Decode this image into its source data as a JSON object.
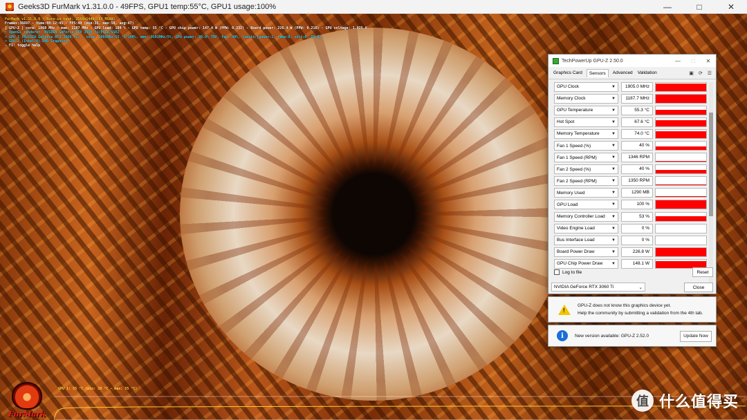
{
  "furmark": {
    "window_title": "Geeks3D FurMark v1.31.0.0 - 49FPS, GPU1 temp:55°C, GPU1 usage:100%",
    "hud": [
      {
        "text": "FurMark v1.31.0.0 - Burn-in test, 2560x1440 (8X MSAA)",
        "color": "#ffd633"
      },
      {
        "text": "Frames:36697 - time:00:12:45 - FPS:49 (min:35, max:58, avg:47)",
        "color": "#ffffff"
      },
      {
        "text": "[ GPU-Z ] core: 1860 MHz - mem: 1187 MHz - GPU load: 100 % - GPU temp: 55 °C - GPU chip power: 147.4 W (PPW: 0.332) - Board power: 226.4 W (PPW: 0.216) - GPU voltage: 1.025 V",
        "color": "#ffffff"
      },
      {
        "text": "> OpenGL renderer: NVIDIA GeForce RTX 3060 Ti/PCIe/SSE2",
        "color": "#33d6ff"
      },
      {
        "text": "> GPU 1 (NVIDIA GeForce RTX 3060 Ti) - core: 1905MHz/55 °C/100%, mem: 9501MHz/5%, GPU power: 99.8% TDP, fan: 40%, limits:[power:1, temp:0, volt:0, OV:0]",
        "color": "#33d6ff"
      },
      {
        "text": "> GPU 2 (Intel(R) UHD Graphics)",
        "color": "#33d6ff"
      },
      {
        "text": "- F1: toggle help",
        "color": "#ffffff"
      }
    ],
    "graph_label": "GPU 1: 55 °C (min: 28 °C - max: 55 °C)",
    "logo_text": "FurMark"
  },
  "gpuz": {
    "window_title": "TechPowerUp GPU-Z 2.50.0",
    "tabs": [
      "Graphics Card",
      "Sensors",
      "Advanced",
      "Validation"
    ],
    "active_tab": "Sensors",
    "sensors": [
      {
        "name": "GPU Clock",
        "value": "1905.0 MHz",
        "level": 0.9
      },
      {
        "name": "Memory Clock",
        "value": "1187.7 MHz",
        "level": 0.95
      },
      {
        "name": "GPU Temperature",
        "value": "55.3 °C",
        "level": 0.55
      },
      {
        "name": "Hot Spot",
        "value": "67.6 °C",
        "level": 0.7
      },
      {
        "name": "Memory Temperature",
        "value": "74.0 °C",
        "level": 0.8
      },
      {
        "name": "Fan 1 Speed (%)",
        "value": "40 %",
        "level": 0.4
      },
      {
        "name": "Fan 1 Speed (RPM)",
        "value": "1346 RPM",
        "level": 0.1
      },
      {
        "name": "Fan 2 Speed (%)",
        "value": "40 %",
        "level": 0.4
      },
      {
        "name": "Fan 2 Speed (RPM)",
        "value": "1350 RPM",
        "level": 0.1
      },
      {
        "name": "Memory Used",
        "value": "1290 MB",
        "level": 0.15
      },
      {
        "name": "GPU Load",
        "value": "100 %",
        "level": 1.0
      },
      {
        "name": "Memory Controller Load",
        "value": "53 %",
        "level": 0.53
      },
      {
        "name": "Video Engine Load",
        "value": "0 %",
        "level": 0.0
      },
      {
        "name": "Bus Interface Load",
        "value": "0 %",
        "level": 0.0
      },
      {
        "name": "Board Power Draw",
        "value": "226.8 W",
        "level": 0.95
      },
      {
        "name": "GPU Chip Power Draw",
        "value": "148.1 W",
        "level": 0.85
      }
    ],
    "log_to_file_label": "Log to file",
    "reset_label": "Reset",
    "gpu_select_value": "NVIDIA GeForce RTX 3060 Ti",
    "close_label": "Close"
  },
  "notifications": {
    "unknown_device_line1": "GPU-Z does not know this graphics device yet.",
    "unknown_device_line2": "Help the community by submitting a validation from the 4th tab.",
    "update_text": "New version available: GPU-Z 2.52.0",
    "update_button": "Update Now"
  },
  "watermark": {
    "icon_glyph": "值",
    "text": "什么值得买"
  },
  "colors": {
    "sensor_bar": "#ff0000",
    "hud_yellow": "#ffd633",
    "hud_cyan": "#33d6ff"
  }
}
